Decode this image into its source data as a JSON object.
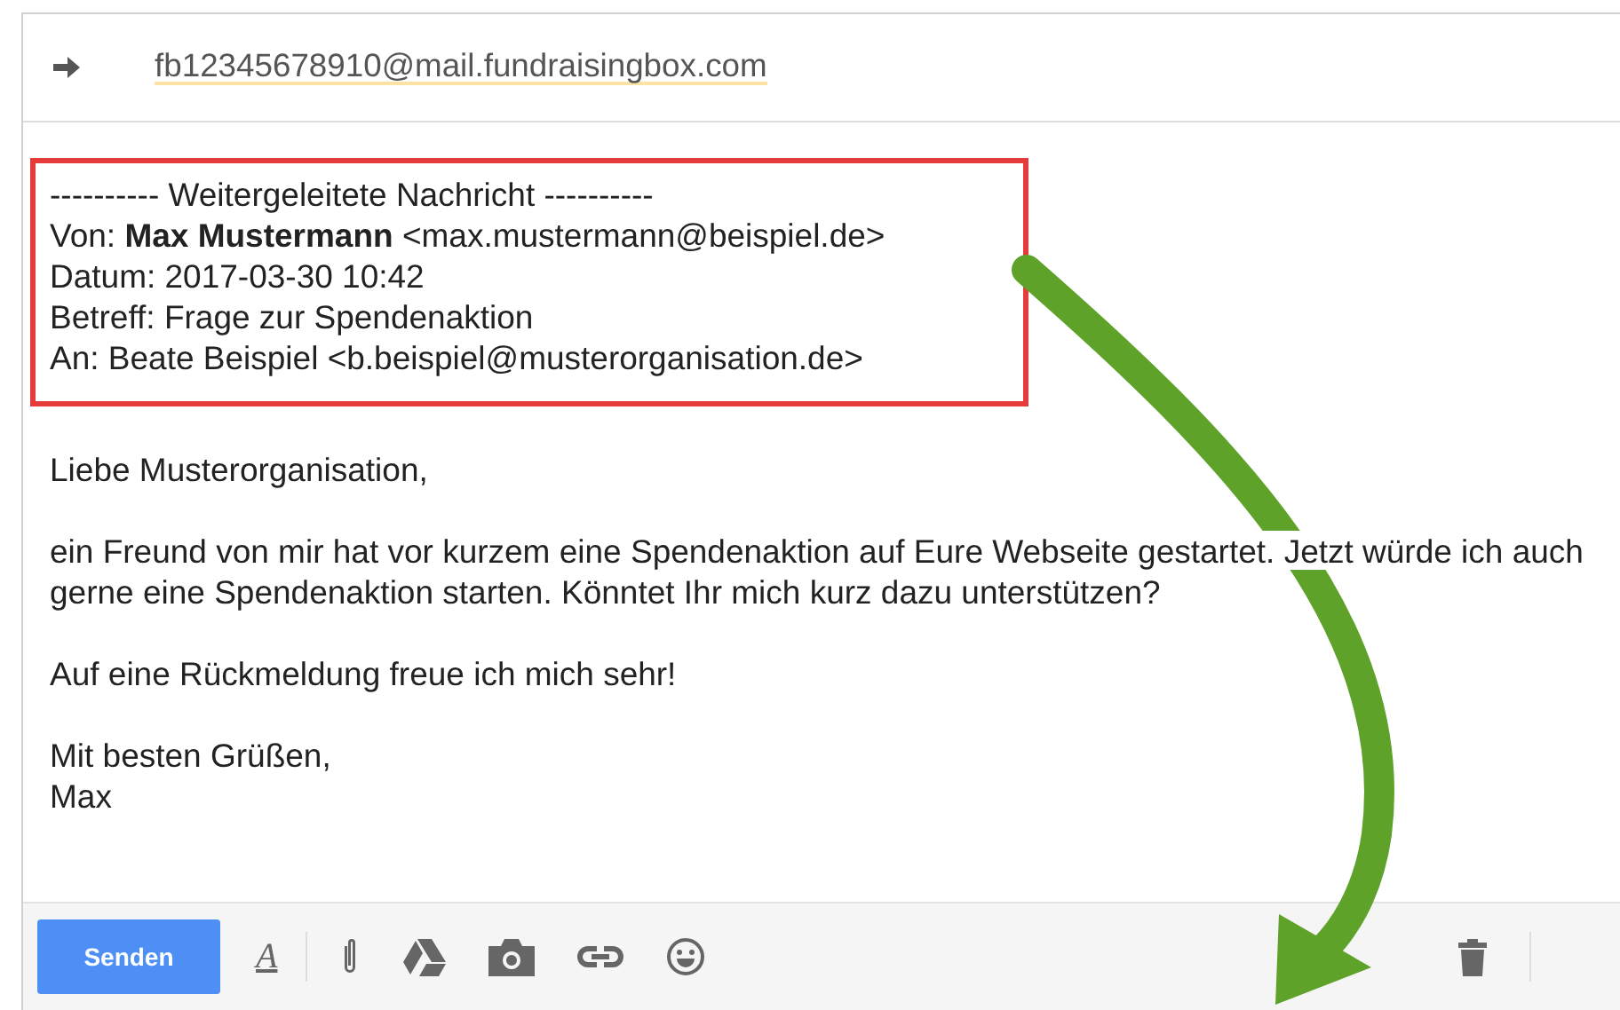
{
  "recipient": "fb12345678910@mail.fundraisingbox.com",
  "forwarded": {
    "header": "---------- Weitergeleitete Nachricht ----------",
    "lines": [
      "Von: **Max Mustermann** <max.mustermann@beispiel.de>",
      "Datum: 2017-03-30 10:42",
      "Betreff: Frage zur Spendenaktion",
      "An: Beate Beispiel <b.beispiel@musterorganisation.de>"
    ]
  },
  "body": [
    [
      "Liebe Musterorganisation,"
    ],
    [
      "ein Freund von mir hat vor kurzem eine Spendenaktion auf Eure Webseite gestartet. Jetzt würde ich auch",
      "gerne eine Spendenaktion starten. Könntet Ihr mich kurz dazu unterstützen?"
    ],
    [
      "Auf eine Rückmeldung freue ich mich sehr!"
    ],
    [
      "Mit besten Grüßen,",
      "Max"
    ]
  ],
  "toolbar": {
    "send": "Senden",
    "format": "A"
  }
}
